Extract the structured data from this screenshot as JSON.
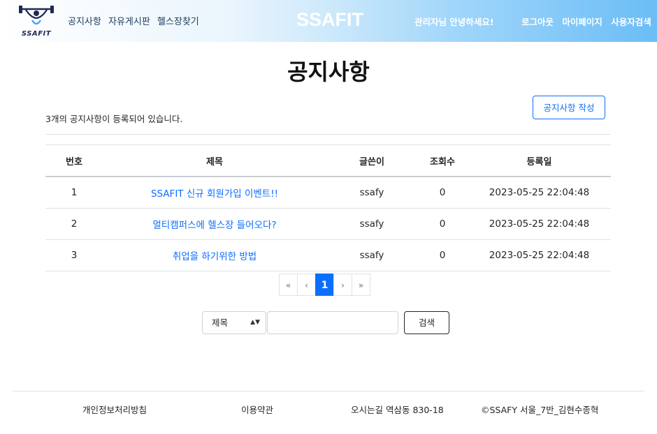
{
  "header": {
    "logo_text": "SSAFIT",
    "nav_left": [
      "공지사항",
      "자유게시판",
      "헬스장찾기"
    ],
    "brand": "SSAFIT",
    "greeting": "관리자님 안녕하세요!",
    "nav_right": [
      "로그아웃",
      "마이페이지",
      "사용자검색"
    ]
  },
  "main": {
    "title": "공지사항",
    "count_text": "3개의 공지사항이 등록되어 있습니다.",
    "write_button": "공지사항 작성"
  },
  "table": {
    "columns": [
      "번호",
      "제목",
      "글쓴이",
      "조회수",
      "등록일"
    ],
    "rows": [
      {
        "no": "1",
        "title": "SSAFIT 신규 회원가입 이벤트!!",
        "writer": "ssafy",
        "views": "0",
        "date": "2023-05-25 22:04:48"
      },
      {
        "no": "2",
        "title": "멀티캠퍼스에 헬스장 들어오다?",
        "writer": "ssafy",
        "views": "0",
        "date": "2023-05-25 22:04:48"
      },
      {
        "no": "3",
        "title": "취업을 하기위한 방법",
        "writer": "ssafy",
        "views": "0",
        "date": "2023-05-25 22:04:48"
      }
    ]
  },
  "pagination": {
    "first": "«",
    "prev": "‹",
    "current": "1",
    "next": "›",
    "last": "»"
  },
  "search": {
    "select_value": "제목",
    "input_value": "",
    "button_label": "검색"
  },
  "footer": {
    "privacy": "개인정보처리방침",
    "terms": "이용약관",
    "address": "오시는길 역삼동 830-18",
    "copyright": "©SSAFY 서울_7반_김현수종혁"
  },
  "colors": {
    "primary": "#0d6efd",
    "header_gradient_end": "#6bbdf6",
    "logo_navy": "#1e2a55"
  },
  "icons": {
    "logo": "weightlifter-logo-icon",
    "select_arrow": "updown-arrow-icon"
  }
}
